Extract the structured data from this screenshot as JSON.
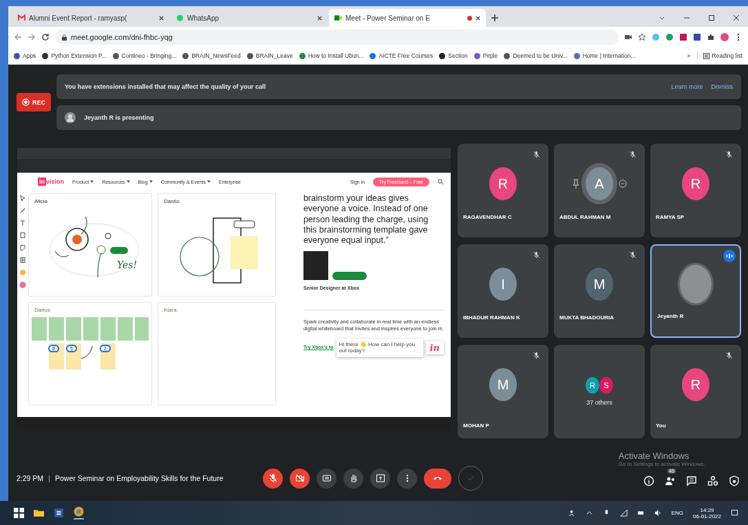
{
  "browser": {
    "tabs": [
      {
        "title": "Alumni Event Report - ramyasp(",
        "selected": false
      },
      {
        "title": "WhatsApp",
        "selected": false
      },
      {
        "title": "Meet - Power Seminar on E",
        "selected": true
      }
    ],
    "url": "meet.google.com/dni-fhbc-yqg",
    "bookmarks": [
      "Apps",
      "Python Extension P...",
      "Contineo - Bringing...",
      "BRAIN_NewsFeed",
      "BRAIN_Leave",
      "How to Install Ubun...",
      "AICTE Free Courses",
      "Section",
      "Pirple",
      "Deemed to be Univ...",
      "Home | Internation..."
    ],
    "bookmarks_more": "»",
    "reading_list": "Reading list"
  },
  "meet": {
    "rec": "REC",
    "banner": {
      "text": "You have extensions installed that may affect the quality of your call",
      "links": [
        "Learn more",
        "Dismiss"
      ]
    },
    "presenting": "Jeyanth R is presenting",
    "shared_screen": {
      "logo_mark": "in",
      "logo_text": "vision",
      "nav": [
        "Product",
        "Resources",
        "Blog",
        "Community & Events",
        "Enterprise"
      ],
      "sign_in": "Sign in",
      "cta": "Try Freehand – Free",
      "boards": [
        {
          "name": "Alicia",
          "kind": "sketch"
        },
        {
          "name": "Danilo",
          "kind": "shapes"
        },
        {
          "name": "Darius",
          "kind": "notes"
        },
        {
          "name": "Kiara",
          "kind": "empty"
        }
      ],
      "sketch_word": "Yes!",
      "votes": [
        "8",
        "5",
        "2"
      ],
      "quote": "brainstorm your ideas gives everyone a voice. Instead of one person leading the charge, using this brainstorming template gave everyone equal input.”",
      "role": "Senior Designer at Xbox",
      "pitch": "Spark creativity and collaborate in real time with an endless digital whiteboard that invites and inspires everyone to join in.",
      "link": "Try Xbox's to",
      "chat": "Hi there 👋 How can I help you out today?",
      "chat_logo": "in"
    },
    "tiles": [
      {
        "kind": "person",
        "name": "RAGAVENDHAR C",
        "initial": "R",
        "color": "#e8467c",
        "muted": true,
        "hovered": false,
        "selected": false
      },
      {
        "kind": "person",
        "name": "ABDUL RAHMAN M",
        "initial": "A",
        "color": "#7b8e98",
        "muted": true,
        "hovered": true,
        "selected": false
      },
      {
        "kind": "person",
        "name": "RAMYA SP",
        "initial": "R",
        "color": "#e8467c",
        "muted": true,
        "hovered": false,
        "selected": false
      },
      {
        "kind": "person",
        "name": "IBHADUR RAHMAN K",
        "initial": "I",
        "color": "#7b8e98",
        "muted": true,
        "hovered": false,
        "selected": false
      },
      {
        "kind": "person",
        "name": "MUKTA BHADOURIA",
        "initial": "M",
        "color": "#52656f",
        "muted": true,
        "hovered": false,
        "selected": false
      },
      {
        "kind": "photo",
        "name": "Jeyanth R",
        "muted": false,
        "hovered": false,
        "selected": true
      },
      {
        "kind": "person",
        "name": "MOHAN P",
        "initial": "M",
        "color": "#7b8e98",
        "muted": true,
        "hovered": false,
        "selected": false
      },
      {
        "kind": "others",
        "label": "37 others",
        "avatars": [
          {
            "initial": "R",
            "color": "#129eaf"
          },
          {
            "initial": "S",
            "color": "#d81b60"
          }
        ]
      },
      {
        "kind": "person",
        "name": "You",
        "initial": "R",
        "color": "#e8467c",
        "muted": true,
        "hovered": false,
        "selected": false
      }
    ],
    "bottom": {
      "time": "2:29 PM",
      "separator": "|",
      "title": "Power Seminar on Employability Skills for the Future",
      "controls": [
        {
          "kind": "mic",
          "on": false
        },
        {
          "kind": "cam",
          "on": false
        },
        {
          "kind": "captions"
        },
        {
          "kind": "hand"
        },
        {
          "kind": "present"
        },
        {
          "kind": "more"
        },
        {
          "kind": "hangup"
        },
        {
          "kind": "check"
        }
      ],
      "activate_title": "Activate Windows",
      "activate_text": "Go to Settings to activate Windows.",
      "people_count": "46"
    }
  },
  "taskbar": {
    "lang": "ENG",
    "time": "14:29",
    "date": "06-01-2022"
  }
}
